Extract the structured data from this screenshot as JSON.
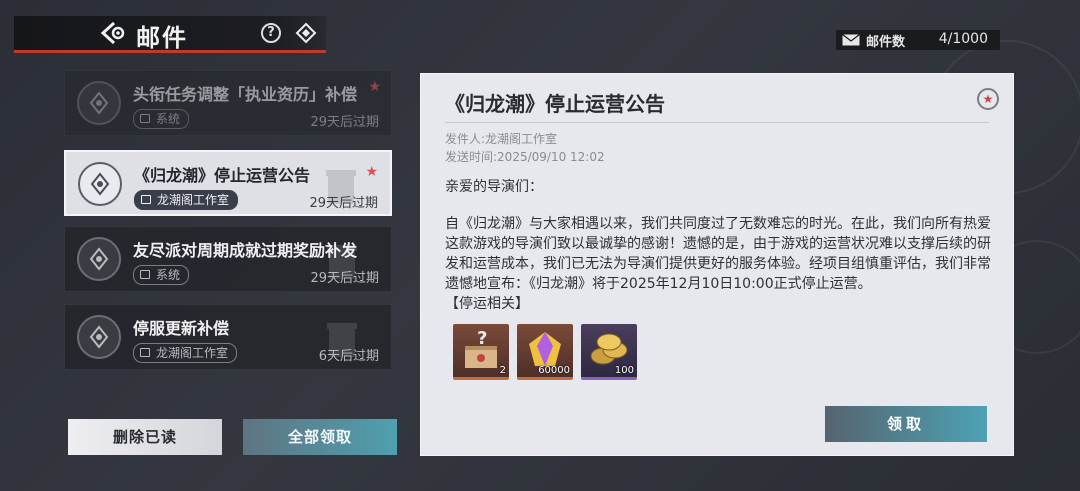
{
  "header": {
    "title": "邮件",
    "help_glyph": "?"
  },
  "mail_count": {
    "label": "邮件数",
    "value": "4/1000"
  },
  "mails": [
    {
      "title": "头衔任务调整「执业资历」补偿",
      "tag": "系统",
      "expiry": "29天后过期",
      "starred": true,
      "star_glyph": "★"
    },
    {
      "title": "《归龙潮》停止运营公告",
      "tag": "龙潮阁工作室",
      "expiry": "29天后过期",
      "starred": true,
      "star_glyph": "★"
    },
    {
      "title": "友尽派对周期成就过期奖励补发",
      "tag": "系统",
      "expiry": "29天后过期",
      "starred": false
    },
    {
      "title": "停服更新补偿",
      "tag": "龙潮阁工作室",
      "expiry": "6天后过期",
      "starred": false
    }
  ],
  "buttons": {
    "delete_read": "删除已读",
    "claim_all": "全部领取",
    "claim": "领取"
  },
  "detail": {
    "title": "《归龙潮》停止运营公告",
    "star_glyph": "★",
    "sender": "发件人:龙潮阁工作室",
    "time": "发送时间:2025/09/10 12:02",
    "greeting": "亲爱的导演们：",
    "body": "自《归龙潮》与大家相遇以来，我们共同度过了无数难忘的时光。在此，我们向所有热爱这款游戏的导演们致以最诚挚的感谢！遗憾的是，由于游戏的运营状况难以支撑后续的研发和运营成本，我们已无法为导演们提供更好的服务体验。经项目组慎重评估，我们非常遗憾地宣布：《归龙潮》将于2025年12月10日10:00正式停止运营。",
    "note": "【停运相关】",
    "attachments": [
      {
        "icon": "mystery-box-icon",
        "qty": "2"
      },
      {
        "icon": "crystal-icon",
        "qty": "60000"
      },
      {
        "icon": "coins-icon",
        "qty": "100"
      }
    ]
  },
  "colors": {
    "accent_red": "#c0392b",
    "claim_teal": "#4da2b4"
  }
}
